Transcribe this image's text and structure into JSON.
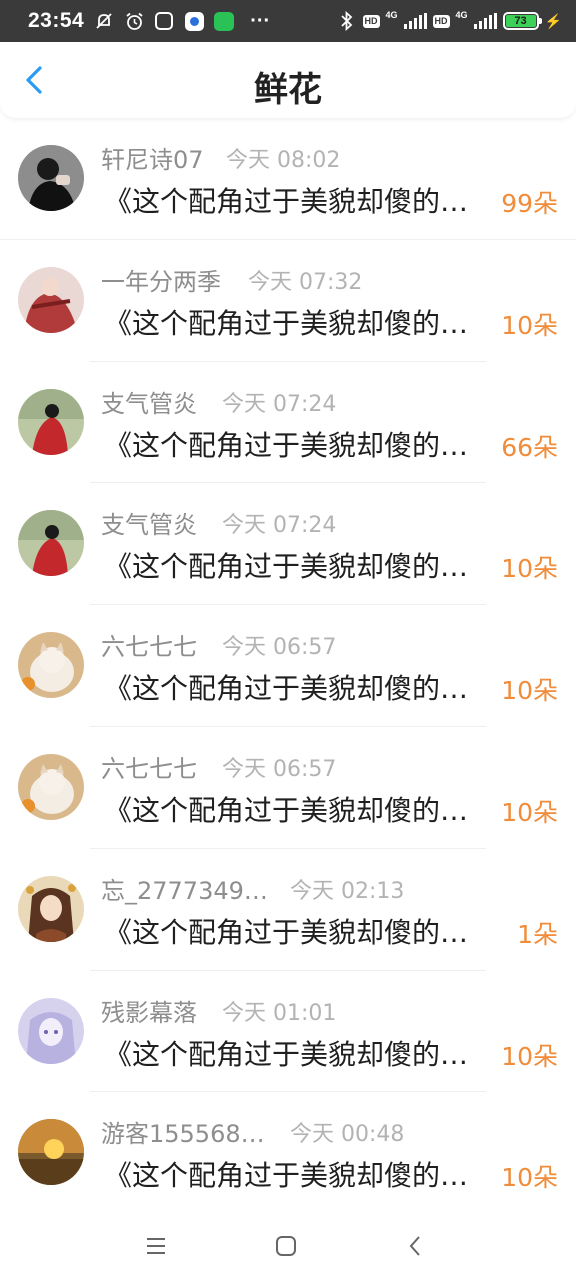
{
  "status_bar": {
    "time": "23:54",
    "network_1": "4G",
    "network_2": "4G",
    "hd_1": "HD",
    "hd_2": "HD",
    "battery": "73",
    "more": "···"
  },
  "header": {
    "title": "鲜花",
    "back_icon": "chevron-left-icon",
    "accent_color": "#2a9bf4"
  },
  "list": [
    {
      "name": "轩尼诗07",
      "time": "今天 08:02",
      "message": "《这个配角过于美貌却傻的小说》",
      "flowers": "99朵",
      "avatar": "avatar-portrait-dark"
    },
    {
      "name": "一年分两季",
      "time": "今天 07:32",
      "message": "《这个配角过于美貌却傻的小说》",
      "flowers": "10朵",
      "avatar": "avatar-red-costume"
    },
    {
      "name": "支气管炎",
      "time": "今天 07:24",
      "message": "《这个配角过于美貌却傻的小说》",
      "flowers": "66朵",
      "avatar": "avatar-red-robe"
    },
    {
      "name": "支气管炎",
      "time": "今天 07:24",
      "message": "《这个配角过于美貌却傻的小说》",
      "flowers": "10朵",
      "avatar": "avatar-red-robe"
    },
    {
      "name": "六七七七",
      "time": "今天 06:57",
      "message": "《这个配角过于美貌却傻的小说》",
      "flowers": "10朵",
      "avatar": "avatar-cat"
    },
    {
      "name": "六七七七",
      "time": "今天 06:57",
      "message": "《这个配角过于美貌却傻的小说》",
      "flowers": "10朵",
      "avatar": "avatar-cat"
    },
    {
      "name": "忘_2777349…",
      "time": "今天 02:13",
      "message": "《这个配角过于美貌却傻的小说》",
      "flowers": "1朵",
      "avatar": "avatar-anime-brown"
    },
    {
      "name": "残影幕落",
      "time": "今天 01:01",
      "message": "《这个配角过于美貌却傻的小说》",
      "flowers": "10朵",
      "avatar": "avatar-anime-purple"
    },
    {
      "name": "游客155568…",
      "time": "今天 00:48",
      "message": "《这个配角过于美貌却傻的小说》",
      "flowers": "10朵",
      "avatar": "avatar-sunset"
    }
  ],
  "colors": {
    "flower_count": "#f08c3a",
    "name": "#8e8e8e",
    "time": "#b3b3b3"
  },
  "navbar": {
    "menu_icon": "menu-icon",
    "home_icon": "home-icon",
    "back_icon": "back-icon"
  }
}
